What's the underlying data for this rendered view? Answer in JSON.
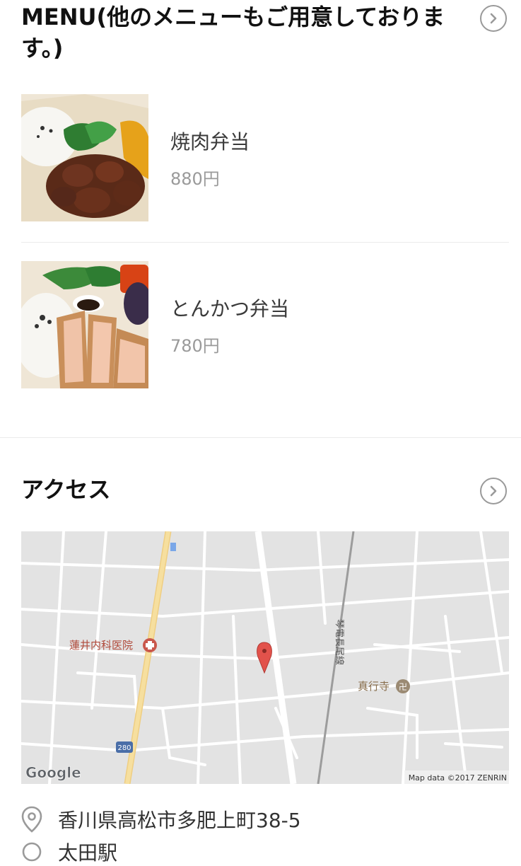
{
  "menu_section": {
    "title": "MENU(他のメニューもご用意しております。)",
    "items": [
      {
        "name": "焼肉弁当",
        "price": "880円"
      },
      {
        "name": "とんかつ弁当",
        "price": "780円"
      }
    ]
  },
  "access_section": {
    "title": "アクセス",
    "map": {
      "labels": {
        "clinic": "蓮井内科医院",
        "temple": "真行寺",
        "railway": "琴電長尾線",
        "route": "280",
        "google": "Google",
        "credit": "Map data ©2017 ZENRIN"
      }
    },
    "address": "香川県高松市多肥上町38-5",
    "next_line_partial": "太田駅"
  },
  "colors": {
    "pin": "#e2524b",
    "map_bg": "#e3e3e3",
    "road": "#ffffff",
    "highway": "#f3d58a",
    "chevron": "#9a9a9a"
  }
}
